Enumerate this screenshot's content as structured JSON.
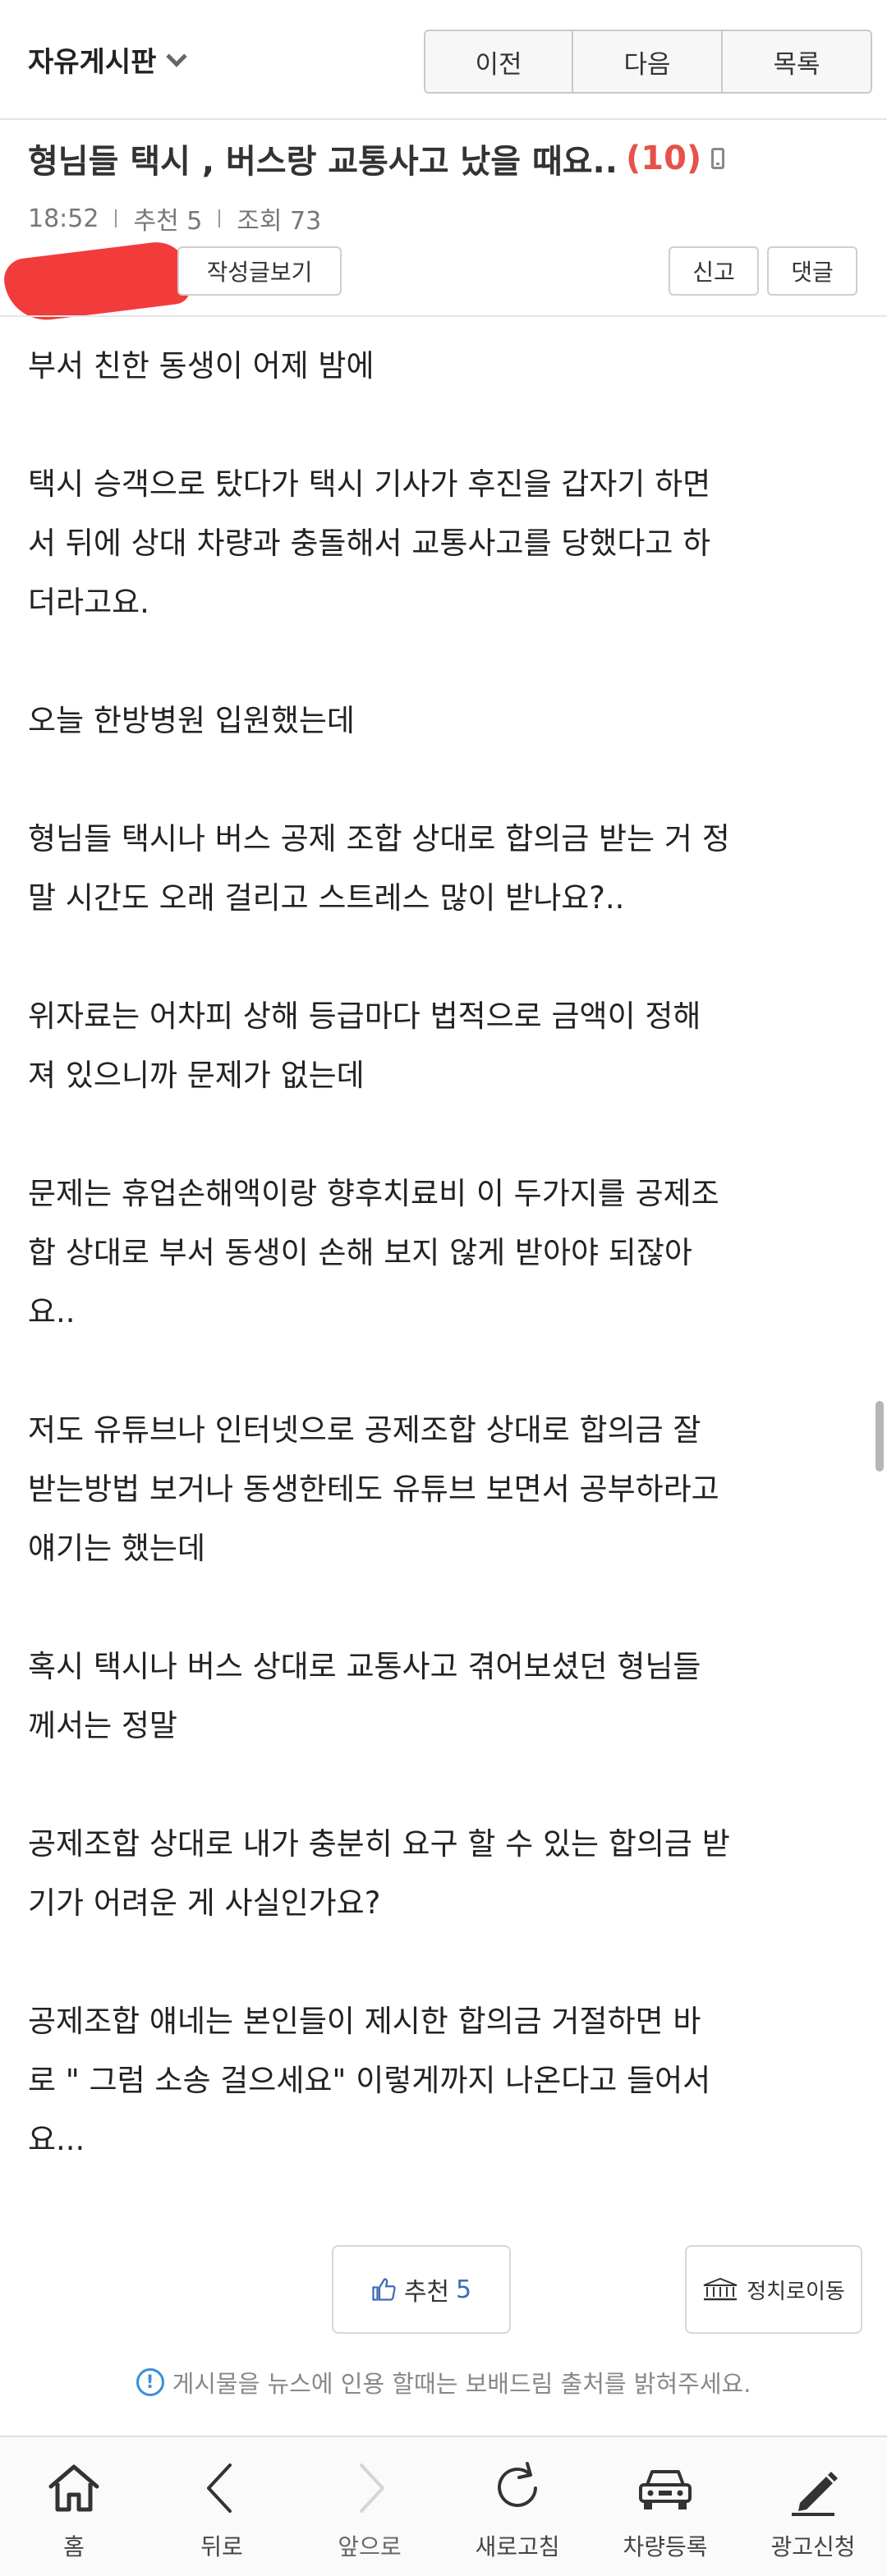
{
  "header": {
    "board_name": "자유게시판",
    "prev_label": "이전",
    "next_label": "다음",
    "list_label": "목록"
  },
  "post": {
    "title": "형님들 택시 , 버스랑 교통사고 났을 때요..",
    "comment_count": "(10)",
    "time": "18:52",
    "recommend": "추천 5",
    "views": "조회 73",
    "author_posts_label": "작성글보기",
    "report_label": "신고",
    "comment_label": "댓글",
    "body": [
      [
        "부서 친한 동생이 어제 밤에"
      ],
      [
        "택시 승객으로 탔다가 택시 기사가 후진을 갑자기 하면",
        "서 뒤에 상대 차량과 충돌해서 교통사고를 당했다고 하",
        "더라고요."
      ],
      [
        "오늘 한방병원 입원했는데"
      ],
      [
        "형님들 택시나 버스 공제 조합 상대로 합의금 받는 거 정",
        "말 시간도 오래 걸리고 스트레스 많이 받나요?.."
      ],
      [
        "위자료는 어차피 상해 등급마다 법적으로 금액이 정해",
        "져 있으니까 문제가 없는데"
      ],
      [
        "문제는 휴업손해액이랑 향후치료비 이 두가지를 공제조",
        "합 상대로 부서 동생이 손해 보지 않게 받아야 되잖아",
        "요.."
      ],
      [
        "저도 유튜브나 인터넷으로 공제조합 상대로 합의금 잘",
        "받는방법 보거나 동생한테도 유튜브 보면서 공부하라고",
        "얘기는 했는데"
      ],
      [
        "혹시 택시나 버스 상대로 교통사고 겪어보셨던 형님들",
        "께서는 정말"
      ],
      [
        "공제조합 상대로 내가 충분히 요구 할 수 있는 합의금 받",
        "기가 어려운 게 사실인가요?"
      ],
      [
        "공제조합 얘네는 본인들이 제시한 합의금 거절하면 바",
        "로 \" 그럼 소송 걸으세요\" 이렇게까지 나온다고 들어서",
        "요..."
      ]
    ]
  },
  "actions": {
    "like_label": "추천",
    "like_count": "5",
    "move_label": "정치로이동"
  },
  "notice": "게시물을 뉴스에 인용 할때는 보배드림 출처를 밝혀주세요.",
  "bottom_nav": {
    "home": "홈",
    "back": "뒤로",
    "forward": "앞으로",
    "refresh": "새로고침",
    "car_register": "차량등록",
    "ad_request": "광고신청"
  },
  "colors": {
    "accent_red": "#e8514a",
    "like_blue": "#3a6db4",
    "info_blue": "#3a8fd6"
  }
}
